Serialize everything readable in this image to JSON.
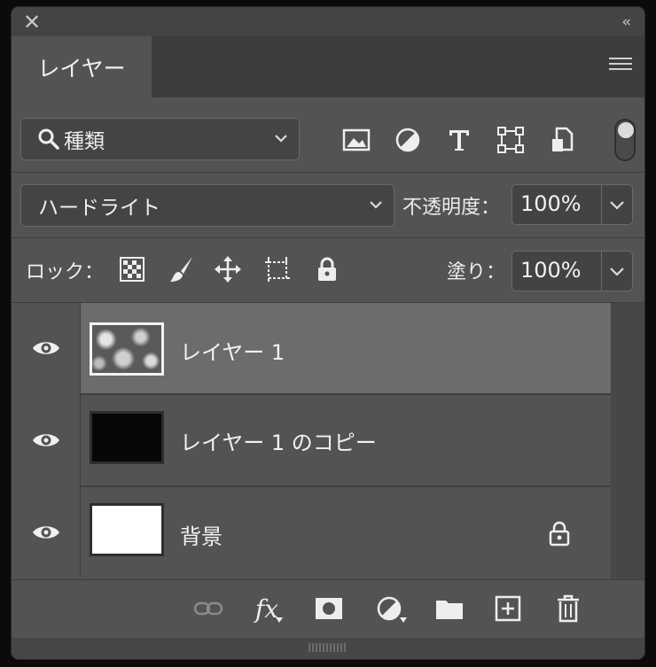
{
  "window": {
    "close_icon": "close-icon",
    "collapse_label": "‹‹"
  },
  "tab": {
    "label": "レイヤー"
  },
  "filter": {
    "kind_label": "種類",
    "icons": [
      "image-filter-icon",
      "adjustment-filter-icon",
      "type-filter-icon",
      "shape-filter-icon",
      "smart-object-filter-icon"
    ]
  },
  "blend": {
    "mode": "ハードライト",
    "opacity_label": "不透明度：",
    "opacity_value": "100%"
  },
  "lock": {
    "label": "ロック：",
    "fill_label": "塗り：",
    "fill_value": "100%"
  },
  "layers": [
    {
      "name": "レイヤー 1",
      "selected": true,
      "thumbnail": "noise"
    },
    {
      "name": "レイヤー 1 のコピー",
      "selected": false,
      "thumbnail": "black"
    },
    {
      "name": "背景",
      "selected": false,
      "thumbnail": "white",
      "locked": true
    }
  ],
  "footer": {
    "fx_label": "fx"
  }
}
